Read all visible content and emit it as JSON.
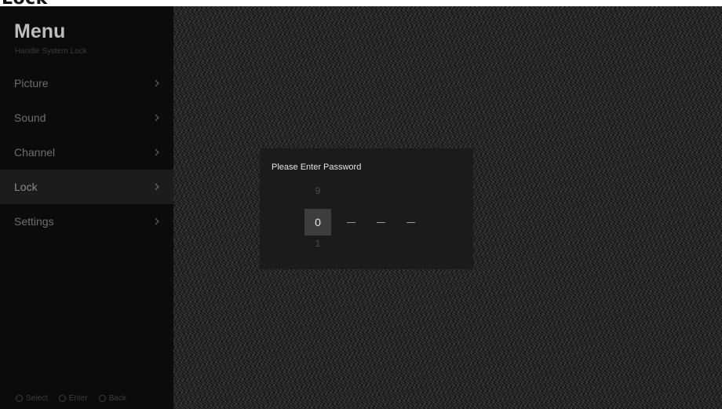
{
  "page": {
    "title": "Lock"
  },
  "sidebar": {
    "title": "Menu",
    "subtitle": "Handle System Lock",
    "items": [
      {
        "label": "Picture",
        "icon": "chevron-right-icon"
      },
      {
        "label": "Sound",
        "icon": "chevron-right-icon"
      },
      {
        "label": "Channel",
        "icon": "chevron-right-icon"
      },
      {
        "label": "Lock",
        "icon": "chevron-right-icon",
        "active": true
      },
      {
        "label": "Settings",
        "icon": "chevron-right-icon"
      }
    ]
  },
  "hints": [
    {
      "icon": "select-icon",
      "label": "Select"
    },
    {
      "icon": "enter-icon",
      "label": "Enter"
    },
    {
      "icon": "back-icon",
      "label": "Back"
    }
  ],
  "dialog": {
    "title": "Please Enter Password",
    "digit_above": "9",
    "digit_current": "0",
    "digit_below": "1",
    "remaining_placeholder": "–"
  }
}
